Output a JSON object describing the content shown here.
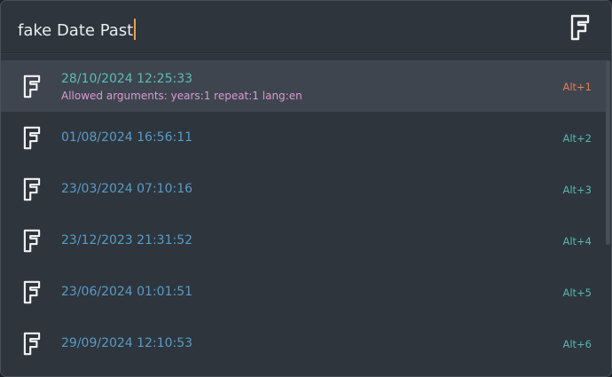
{
  "search": {
    "query": "fake Date Past"
  },
  "results": [
    {
      "title": "28/10/2024 12:25:33",
      "subtitle": "Allowed arguments: years:1 repeat:1 lang:en",
      "shortcut": "Alt+1",
      "selected": true
    },
    {
      "title": "01/08/2024 16:56:11",
      "subtitle": "",
      "shortcut": "Alt+2",
      "selected": false
    },
    {
      "title": "23/03/2024 07:10:16",
      "subtitle": "",
      "shortcut": "Alt+3",
      "selected": false
    },
    {
      "title": "23/12/2023 21:31:52",
      "subtitle": "",
      "shortcut": "Alt+4",
      "selected": false
    },
    {
      "title": "23/06/2024 01:01:51",
      "subtitle": "",
      "shortcut": "Alt+5",
      "selected": false
    },
    {
      "title": "29/09/2024 12:10:53",
      "subtitle": "",
      "shortcut": "Alt+6",
      "selected": false
    }
  ],
  "icons": {
    "search_icon": "f-letter-icon",
    "result_icon": "f-letter-icon"
  },
  "colors": {
    "background": "#2e353d",
    "selected_row": "#3e454f",
    "title": "#5a9bc4",
    "selected_title": "#5dbcb6",
    "subtitle": "#d99ad0",
    "shortcut": "#58b6b0",
    "selected_shortcut": "#e07e55",
    "caret": "#e8a04a"
  }
}
